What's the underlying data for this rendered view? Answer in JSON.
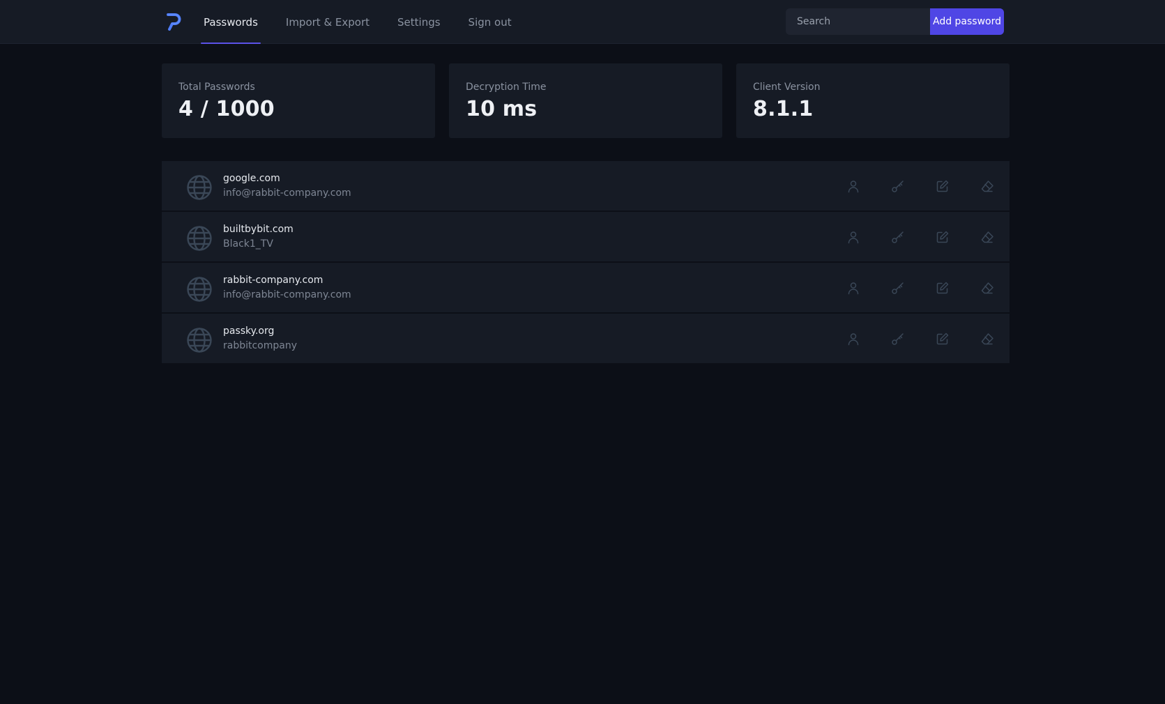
{
  "nav": {
    "items": [
      {
        "label": "Passwords",
        "active": true
      },
      {
        "label": "Import & Export",
        "active": false
      },
      {
        "label": "Settings",
        "active": false
      },
      {
        "label": "Sign out",
        "active": false
      }
    ]
  },
  "search": {
    "placeholder": "Search",
    "value": ""
  },
  "header": {
    "add_label": "Add password"
  },
  "stats": [
    {
      "label": "Total Passwords",
      "value": "4 / 1000"
    },
    {
      "label": "Decryption Time",
      "value": "10 ms"
    },
    {
      "label": "Client Version",
      "value": "8.1.1"
    }
  ],
  "passwords": [
    {
      "site": "google.com",
      "user": "info@rabbit-company.com"
    },
    {
      "site": "builtbybit.com",
      "user": "Black1_TV"
    },
    {
      "site": "rabbit-company.com",
      "user": "info@rabbit-company.com"
    },
    {
      "site": "passky.org",
      "user": "rabbitcompany"
    }
  ],
  "icons": {
    "logo": "passky-logo-icon",
    "row": "globe-icon",
    "actions": [
      "user-icon",
      "key-icon",
      "edit-icon",
      "eraser-icon"
    ]
  },
  "colors": {
    "accent": "#4f46e5",
    "background": "#0c0f17",
    "surface": "#161b25",
    "icon": "#3a4757"
  }
}
